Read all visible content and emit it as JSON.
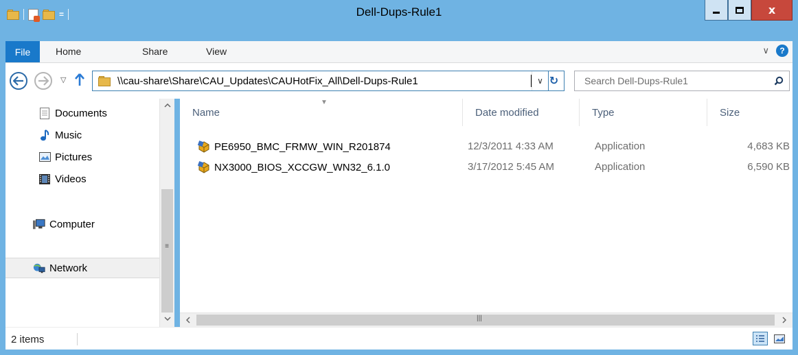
{
  "window": {
    "title": "Dell-Dups-Rule1",
    "close_glyph": "x",
    "qat_arrow": "="
  },
  "ribbon": {
    "file_label": "File",
    "tabs": [
      "Home",
      "Share",
      "View"
    ],
    "expand_glyph": "∨",
    "help_glyph": "?"
  },
  "address": {
    "path": "\\\\cau-share\\Share\\CAU_Updates\\CAUHotFix_All\\Dell-Dups-Rule1",
    "dropdown_glyph": "∨",
    "refresh_glyph": "↻"
  },
  "search": {
    "placeholder": "Search Dell-Dups-Rule1"
  },
  "nav": {
    "items": [
      {
        "label": "Documents",
        "icon": "documents-icon"
      },
      {
        "label": "Music",
        "icon": "music-icon"
      },
      {
        "label": "Pictures",
        "icon": "pictures-icon"
      },
      {
        "label": "Videos",
        "icon": "videos-icon"
      },
      {
        "label": "Computer",
        "icon": "computer-icon"
      },
      {
        "label": "Network",
        "icon": "network-icon",
        "selected": true
      }
    ]
  },
  "columns": {
    "name": "Name",
    "date": "Date modified",
    "type": "Type",
    "size": "Size"
  },
  "files": [
    {
      "name": "PE6950_BMC_FRMW_WIN_R201874",
      "date": "12/3/2011 4:33 AM",
      "type": "Application",
      "size": "4,683 KB"
    },
    {
      "name": "NX3000_BIOS_XCCGW_WN32_6.1.0",
      "date": "3/17/2012 5:45 AM",
      "type": "Application",
      "size": "6,590 KB"
    }
  ],
  "status": {
    "item_count": "2 items"
  },
  "colors": {
    "titlebar": "#6fb3e3",
    "file_tab": "#1979ca",
    "close_button": "#c7483c"
  }
}
